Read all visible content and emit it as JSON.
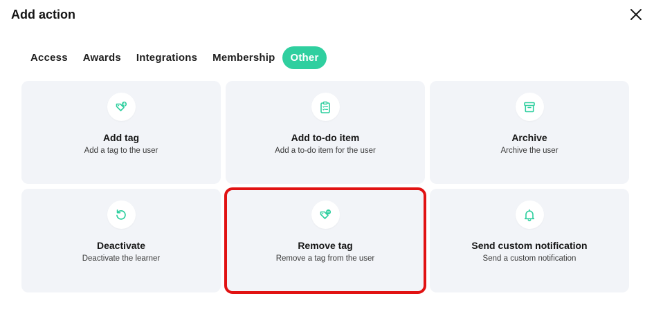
{
  "dialog": {
    "title": "Add action"
  },
  "tabs": [
    {
      "label": "Access",
      "active": false
    },
    {
      "label": "Awards",
      "active": false
    },
    {
      "label": "Integrations",
      "active": false
    },
    {
      "label": "Membership",
      "active": false
    },
    {
      "label": "Other",
      "active": true
    }
  ],
  "cards": [
    {
      "title": "Add tag",
      "description": "Add a tag to the user",
      "icon": "tag-plus-icon"
    },
    {
      "title": "Add to-do item",
      "description": "Add a to-do item for the user",
      "icon": "clipboard-list-icon"
    },
    {
      "title": "Archive",
      "description": "Archive the user",
      "icon": "archive-box-icon"
    },
    {
      "title": "Deactivate",
      "description": "Deactivate the learner",
      "icon": "undo-icon"
    },
    {
      "title": "Remove tag",
      "description": "Remove a tag from the user",
      "icon": "tag-minus-icon",
      "selected": true
    },
    {
      "title": "Send custom notification",
      "description": "Send a custom notification",
      "icon": "bell-icon"
    }
  ],
  "colors": {
    "accent": "#2fcf9f",
    "selection_outline": "#e11212",
    "card_background": "#f2f4f8"
  }
}
